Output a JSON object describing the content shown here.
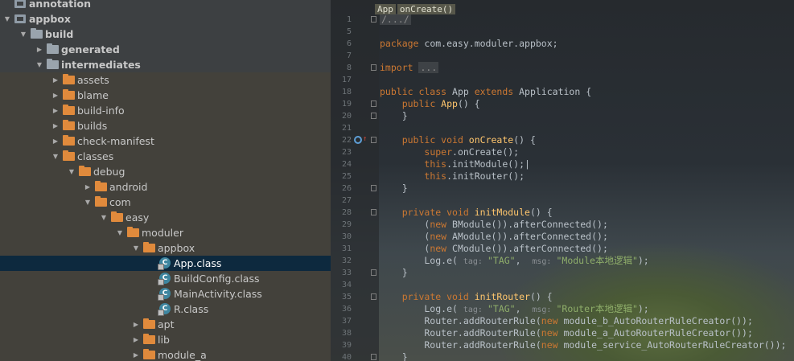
{
  "tree": {
    "items": [
      {
        "label": "annotation",
        "depth": 0,
        "icon": "module",
        "arrow": "none",
        "selected": false
      },
      {
        "label": "appbox",
        "depth": 0,
        "icon": "module",
        "arrow": "down",
        "selected": false
      },
      {
        "label": "build",
        "depth": 1,
        "icon": "folder-grey",
        "arrow": "down",
        "selected": false
      },
      {
        "label": "generated",
        "depth": 2,
        "icon": "folder-grey",
        "arrow": "right",
        "selected": false
      },
      {
        "label": "intermediates",
        "depth": 2,
        "icon": "folder-grey",
        "arrow": "down",
        "selected": false
      },
      {
        "label": "assets",
        "depth": 3,
        "icon": "folder",
        "arrow": "right",
        "selected": false
      },
      {
        "label": "blame",
        "depth": 3,
        "icon": "folder",
        "arrow": "right",
        "selected": false
      },
      {
        "label": "build-info",
        "depth": 3,
        "icon": "folder",
        "arrow": "right",
        "selected": false
      },
      {
        "label": "builds",
        "depth": 3,
        "icon": "folder",
        "arrow": "right",
        "selected": false
      },
      {
        "label": "check-manifest",
        "depth": 3,
        "icon": "folder",
        "arrow": "right",
        "selected": false
      },
      {
        "label": "classes",
        "depth": 3,
        "icon": "folder",
        "arrow": "down",
        "selected": false
      },
      {
        "label": "debug",
        "depth": 4,
        "icon": "folder",
        "arrow": "down",
        "selected": false
      },
      {
        "label": "android",
        "depth": 5,
        "icon": "folder",
        "arrow": "right",
        "selected": false
      },
      {
        "label": "com",
        "depth": 5,
        "icon": "folder",
        "arrow": "down",
        "selected": false
      },
      {
        "label": "easy",
        "depth": 6,
        "icon": "folder",
        "arrow": "down",
        "selected": false
      },
      {
        "label": "moduler",
        "depth": 7,
        "icon": "folder",
        "arrow": "down",
        "selected": false
      },
      {
        "label": "appbox",
        "depth": 8,
        "icon": "folder",
        "arrow": "down",
        "selected": false
      },
      {
        "label": "App.class",
        "depth": 9,
        "icon": "class",
        "arrow": "none",
        "selected": true
      },
      {
        "label": "BuildConfig.class",
        "depth": 9,
        "icon": "class",
        "arrow": "none",
        "selected": false
      },
      {
        "label": "MainActivity.class",
        "depth": 9,
        "icon": "class",
        "arrow": "none",
        "selected": false
      },
      {
        "label": "R.class",
        "depth": 9,
        "icon": "class",
        "arrow": "none",
        "selected": false
      },
      {
        "label": "apt",
        "depth": 8,
        "icon": "folder",
        "arrow": "right",
        "selected": false
      },
      {
        "label": "lib",
        "depth": 8,
        "icon": "folder",
        "arrow": "right",
        "selected": false
      },
      {
        "label": "module_a",
        "depth": 8,
        "icon": "folder",
        "arrow": "right",
        "selected": false
      }
    ]
  },
  "editor": {
    "breadcrumb": [
      "App",
      "onCreate()"
    ],
    "lines": [
      {
        "n": "1",
        "fold": true,
        "tokens": [
          [
            "dim",
            "/.../"
          ]
        ]
      },
      {
        "n": "5",
        "tokens": []
      },
      {
        "n": "6",
        "tokens": [
          [
            "kw",
            "package "
          ],
          [
            "",
            "com.easy.moduler.appbox;"
          ]
        ]
      },
      {
        "n": "7",
        "tokens": []
      },
      {
        "n": "8",
        "fold": true,
        "tokens": [
          [
            "kw",
            "import "
          ],
          [
            "dim",
            "..."
          ]
        ]
      },
      {
        "n": "17",
        "tokens": []
      },
      {
        "n": "18",
        "tokens": [
          [
            "kw",
            "public class "
          ],
          [
            "",
            "App "
          ],
          [
            "kw",
            "extends "
          ],
          [
            "",
            "Application {"
          ]
        ]
      },
      {
        "n": "19",
        "fold": true,
        "tokens": [
          [
            "",
            "    "
          ],
          [
            "kw",
            "public "
          ],
          [
            "fn",
            "App"
          ],
          [
            "",
            "() {"
          ]
        ]
      },
      {
        "n": "20",
        "fold": true,
        "tokens": [
          [
            "",
            "    }"
          ]
        ]
      },
      {
        "n": "21",
        "tokens": []
      },
      {
        "n": "22",
        "fold": true,
        "marker": true,
        "tokens": [
          [
            "",
            "    "
          ],
          [
            "kw",
            "public void "
          ],
          [
            "fn",
            "onCreate"
          ],
          [
            "",
            "() {"
          ]
        ]
      },
      {
        "n": "23",
        "tokens": [
          [
            "",
            "        "
          ],
          [
            "kw",
            "super"
          ],
          [
            "",
            ".onCreate();"
          ]
        ]
      },
      {
        "n": "24",
        "tokens": [
          [
            "",
            "        "
          ],
          [
            "kw",
            "this"
          ],
          [
            "",
            ".initModule();|"
          ]
        ]
      },
      {
        "n": "25",
        "tokens": [
          [
            "",
            "        "
          ],
          [
            "kw",
            "this"
          ],
          [
            "",
            ".initRouter();"
          ]
        ]
      },
      {
        "n": "26",
        "fold": true,
        "tokens": [
          [
            "",
            "    }"
          ]
        ]
      },
      {
        "n": "27",
        "tokens": []
      },
      {
        "n": "28",
        "fold": true,
        "tokens": [
          [
            "",
            "    "
          ],
          [
            "kw",
            "private void "
          ],
          [
            "fn",
            "initModule"
          ],
          [
            "",
            "() {"
          ]
        ]
      },
      {
        "n": "29",
        "tokens": [
          [
            "",
            "        ("
          ],
          [
            "kw",
            "new "
          ],
          [
            "",
            "BModule()).afterConnected();"
          ]
        ]
      },
      {
        "n": "30",
        "tokens": [
          [
            "",
            "        ("
          ],
          [
            "kw",
            "new "
          ],
          [
            "",
            "AModule()).afterConnected();"
          ]
        ]
      },
      {
        "n": "31",
        "tokens": [
          [
            "",
            "        ("
          ],
          [
            "kw",
            "new "
          ],
          [
            "",
            "CModule()).afterConnected();"
          ]
        ]
      },
      {
        "n": "32",
        "tokens": [
          [
            "",
            "        Log.e( "
          ],
          [
            "hint",
            "tag: "
          ],
          [
            "str",
            "\"TAG\""
          ],
          [
            "",
            ",  "
          ],
          [
            "hint",
            "msg: "
          ],
          [
            "str",
            "\"Module本地逻辑\""
          ],
          [
            "",
            ");"
          ]
        ]
      },
      {
        "n": "33",
        "fold": true,
        "tokens": [
          [
            "",
            "    }"
          ]
        ]
      },
      {
        "n": "34",
        "tokens": []
      },
      {
        "n": "35",
        "fold": true,
        "tokens": [
          [
            "",
            "    "
          ],
          [
            "kw",
            "private void "
          ],
          [
            "fn",
            "initRouter"
          ],
          [
            "",
            "() {"
          ]
        ]
      },
      {
        "n": "36",
        "tokens": [
          [
            "",
            "        Log.e( "
          ],
          [
            "hint",
            "tag: "
          ],
          [
            "str",
            "\"TAG\""
          ],
          [
            "",
            ",  "
          ],
          [
            "hint",
            "msg: "
          ],
          [
            "str",
            "\"Router本地逻辑\""
          ],
          [
            "",
            ");"
          ]
        ]
      },
      {
        "n": "37",
        "tokens": [
          [
            "",
            "        Router.addRouterRule("
          ],
          [
            "kw",
            "new "
          ],
          [
            "",
            "module_b_AutoRouterRuleCreator());"
          ]
        ]
      },
      {
        "n": "38",
        "tokens": [
          [
            "",
            "        Router.addRouterRule("
          ],
          [
            "kw",
            "new "
          ],
          [
            "",
            "module_a_AutoRouterRuleCreator());"
          ]
        ]
      },
      {
        "n": "39",
        "tokens": [
          [
            "",
            "        Router.addRouterRule("
          ],
          [
            "kw",
            "new "
          ],
          [
            "",
            "module_service_AutoRouterRuleCreator());"
          ]
        ]
      },
      {
        "n": "40",
        "fold": true,
        "tokens": [
          [
            "",
            "    }"
          ]
        ]
      }
    ]
  },
  "colors": {
    "selection": "#0d293e",
    "keyword": "#cc7832",
    "method": "#ffc66d",
    "string": "#8fae6a",
    "folder": "#e08a3c"
  }
}
